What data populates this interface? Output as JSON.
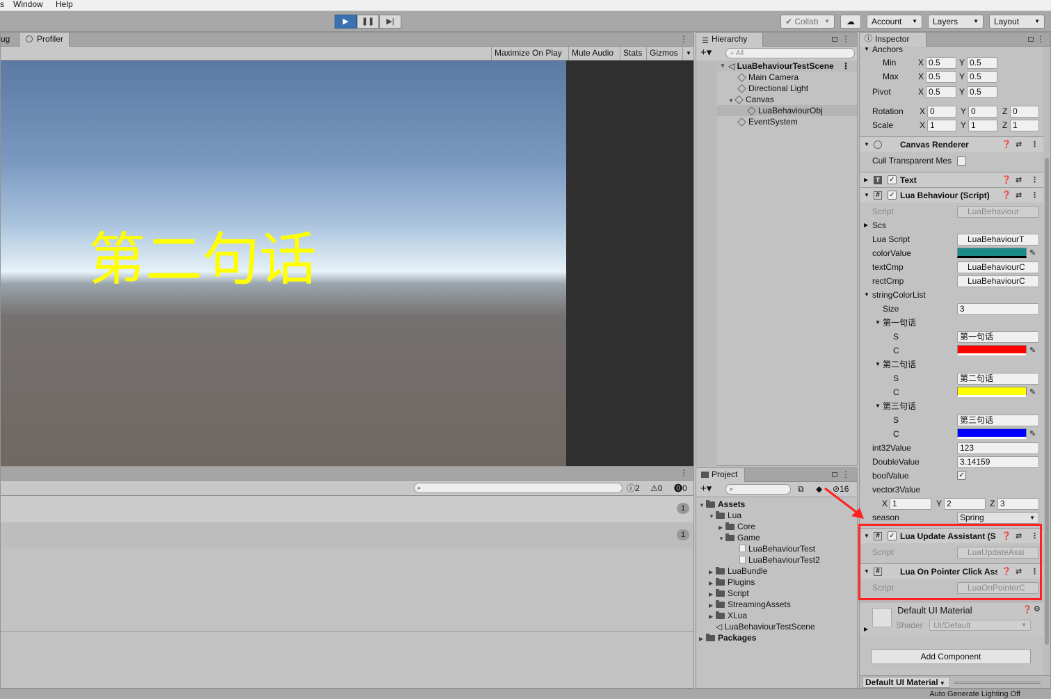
{
  "menubar": {
    "items": [
      "s",
      "Window",
      "Help"
    ]
  },
  "toolbar": {
    "collab": "Collab",
    "account": "Account",
    "layers": "Layers",
    "layout": "Layout"
  },
  "game": {
    "tab_debug": "ug",
    "tab_profiler": "Profiler",
    "maximize": "Maximize On Play",
    "mute": "Mute Audio",
    "stats": "Stats",
    "gizmos": "Gizmos",
    "overlay_text": "第二句话"
  },
  "console": {
    "count_log": "2",
    "count_warn": "0",
    "count_err": "0",
    "row_badges": [
      "1",
      "1"
    ]
  },
  "hierarchy": {
    "tab": "Hierarchy",
    "search": "All",
    "scene": "LuaBehaviourTestScene",
    "items": [
      "Main Camera",
      "Directional Light",
      "Canvas",
      "LuaBehaviourObj",
      "EventSystem"
    ]
  },
  "project": {
    "tab": "Project",
    "hidden_count": "16",
    "assets": "Assets",
    "lua": "Lua",
    "core": "Core",
    "game": "Game",
    "files": [
      "LuaBehaviourTest",
      "LuaBehaviourTest2"
    ],
    "folders": [
      "LuaBundle",
      "Plugins",
      "Script",
      "StreamingAssets",
      "XLua"
    ],
    "scene": "LuaBehaviourTestScene",
    "packages": "Packages"
  },
  "inspector": {
    "tab": "Inspector",
    "anchors": "Anchors",
    "min_label": "Min",
    "min_x": "0.5",
    "min_y": "0.5",
    "max_label": "Max",
    "max_x": "0.5",
    "max_y": "0.5",
    "pivot_label": "Pivot",
    "pivot_x": "0.5",
    "pivot_y": "0.5",
    "rotation_label": "Rotation",
    "rot_x": "0",
    "rot_y": "0",
    "rot_z": "0",
    "scale_label": "Scale",
    "scale_x": "1",
    "scale_y": "1",
    "scale_z": "1",
    "canvas_renderer": "Canvas Renderer",
    "cull": "Cull Transparent Mes",
    "text_comp": "Text",
    "lua_behaviour": "Lua Behaviour (Script)",
    "script_label": "Script",
    "script_value": "LuaBehaviour",
    "scs": "Scs",
    "lua_script": "Lua Script",
    "lua_script_value": "LuaBehaviourT",
    "color_value": "colorValue",
    "text_cmp": "textCmp",
    "text_cmp_value": "LuaBehaviourC",
    "rect_cmp": "rectCmp",
    "rect_cmp_value": "LuaBehaviourC",
    "string_color_list": "stringColorList",
    "size_label": "Size",
    "size_value": "3",
    "elements": [
      {
        "header": "第一句话",
        "s_label": "S",
        "s_value": "第一句话",
        "c_label": "C",
        "color": "#ff0000"
      },
      {
        "header": "第二句话",
        "s_label": "S",
        "s_value": "第二句话",
        "c_label": "C",
        "color": "#ffff00"
      },
      {
        "header": "第三句话",
        "s_label": "S",
        "s_value": "第三句话",
        "c_label": "C",
        "color": "#0000ff"
      }
    ],
    "int32": "int32Value",
    "int32_value": "123",
    "double": "DoubleValue",
    "double_value": "3.14159",
    "bool": "boolValue",
    "vector3": "vector3Value",
    "v3_x": "1",
    "v3_y": "2",
    "v3_z": "3",
    "season": "season",
    "season_value": "Spring",
    "update_assistant": "Lua Update Assistant (S",
    "update_script_value": "LuaUpdateAssi",
    "pointer_click": "Lua On Pointer Click Ass",
    "pointer_script_value": "LuaOnPointerC",
    "material": "Default UI Material",
    "shader_label": "Shader",
    "shader_value": "UI/Default",
    "add_component": "Add Component",
    "footer_material": "Default UI Material"
  },
  "status": {
    "text": "Auto Generate Lighting Off"
  },
  "colors": {
    "teal": "#1d8a8a",
    "highlight": "#ff2020"
  }
}
